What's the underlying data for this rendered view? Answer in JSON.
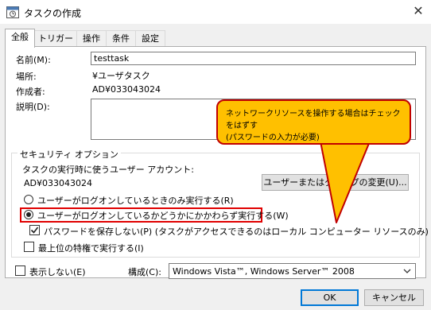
{
  "window": {
    "title": "タスクの作成",
    "close_glyph": "✕"
  },
  "tabs": [
    {
      "label": "全般"
    },
    {
      "label": "トリガー"
    },
    {
      "label": "操作"
    },
    {
      "label": "条件"
    },
    {
      "label": "設定"
    }
  ],
  "general": {
    "name_label": "名前(M):",
    "name_value": "testtask",
    "location_label": "場所:",
    "location_value": "¥ユーザタスク",
    "author_label": "作成者:",
    "author_value": "AD¥033043024",
    "description_label": "説明(D):",
    "description_value": ""
  },
  "callout": {
    "text_line1": "ネットワークリソースを操作する場合はチェックをはずす",
    "text_line2": "(パスワードの入力が必要)"
  },
  "security": {
    "group_title": "セキュリティ オプション",
    "account_prompt": "タスクの実行時に使うユーザー アカウント:",
    "account_value": "AD¥033043024",
    "change_button": "ユーザーまたはグループの変更(U)...",
    "radio_logged_on_only": "ユーザーがログオンしているときのみ実行する(R)",
    "radio_whether_logged_on": "ユーザーがログオンしているかどうかにかかわらず実行する(W)",
    "radio_selected": "whether_logged_on",
    "do_not_store_password": "パスワードを保存しない(P) (タスクがアクセスできるのはローカル コンピューター リソースのみ)",
    "do_not_store_password_checked": true,
    "highest_privileges": "最上位の特権で実行する(I)",
    "highest_privileges_checked": false
  },
  "footer": {
    "hidden_label": "表示しない(E)",
    "hidden_checked": false,
    "configure_label": "構成(C):",
    "configure_value": "Windows Vista™, Windows Server™ 2008",
    "ok_button": "OK",
    "cancel_button": "キャンセル"
  },
  "colors": {
    "callout_fill": "#ffc000",
    "callout_border": "#c00000",
    "highlight_border": "#e00000",
    "ok_border": "#0078d7"
  },
  "icons": {
    "title_icon": "task-scheduler-icon",
    "dropdown": "chevron-down-icon",
    "check": "checkmark-icon"
  }
}
